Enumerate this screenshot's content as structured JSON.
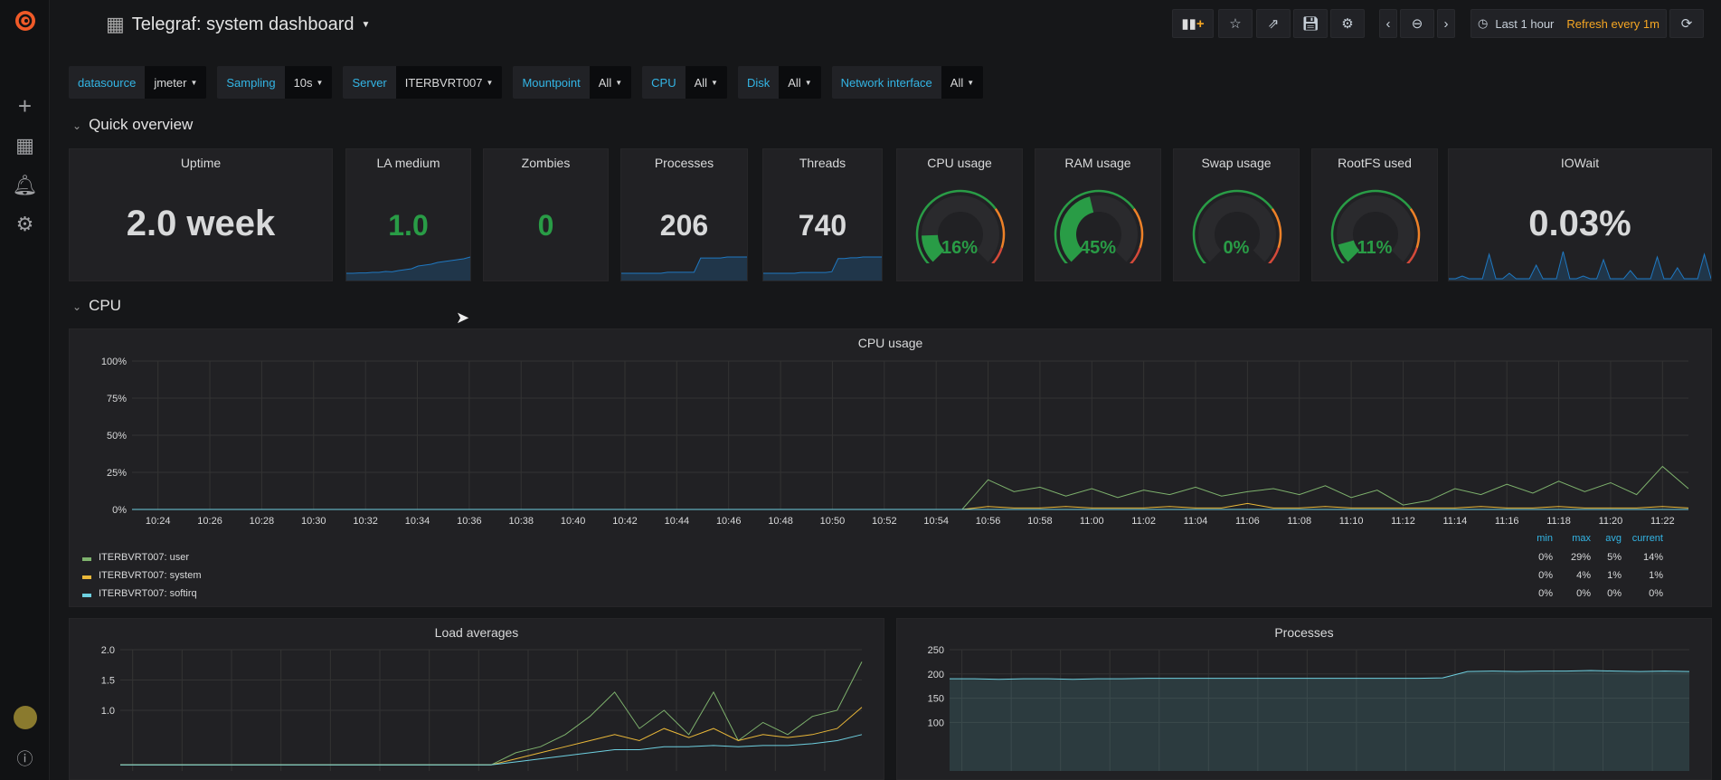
{
  "app": {
    "title": "Telegraf: system dashboard"
  },
  "sidebar": {
    "icons": [
      "grafana-logo",
      "plus-icon",
      "dashboards-icon",
      "bell-icon",
      "gear-icon",
      "avatar",
      "help-icon"
    ]
  },
  "toolbar": {
    "time_range": "Last 1 hour",
    "refresh": "Refresh every 1m",
    "icons": [
      "add-panel-icon",
      "star-icon",
      "share-icon",
      "save-icon",
      "settings-icon",
      "chevron-left-icon",
      "zoom-out-icon",
      "chevron-right-icon",
      "refresh-icon"
    ]
  },
  "variables": [
    {
      "label": "datasource",
      "value": "jmeter"
    },
    {
      "label": "Sampling",
      "value": "10s"
    },
    {
      "label": "Server",
      "value": "ITERBVRT007"
    },
    {
      "label": "Mountpoint",
      "value": "All"
    },
    {
      "label": "CPU",
      "value": "All"
    },
    {
      "label": "Disk",
      "value": "All"
    },
    {
      "label": "Network interface",
      "value": "All"
    }
  ],
  "rows": {
    "quick": "Quick overview",
    "cpu": "CPU"
  },
  "stats": [
    {
      "title": "Uptime",
      "value": "2.0 week",
      "color": "#d8d9da"
    },
    {
      "title": "LA medium",
      "value": "1.0",
      "color": "#299c46",
      "spark": [
        0.1,
        0.1,
        0.12,
        0.12,
        0.15,
        0.15,
        0.2,
        0.18,
        0.25,
        0.3,
        0.35,
        0.5,
        0.55,
        0.6,
        0.7,
        0.75,
        0.8,
        0.85,
        0.9,
        1.0
      ]
    },
    {
      "title": "Zombies",
      "value": "0",
      "color": "#299c46"
    },
    {
      "title": "Processes",
      "value": "206",
      "color": "#d8d9da",
      "spark": [
        190,
        190,
        190,
        190,
        190,
        190,
        190,
        191,
        191,
        191,
        191,
        191,
        205,
        205,
        205,
        205,
        206,
        206,
        206,
        206
      ]
    },
    {
      "title": "Threads",
      "value": "740",
      "color": "#d8d9da",
      "spark": [
        720,
        720,
        720,
        720,
        720,
        720,
        721,
        721,
        721,
        721,
        721,
        722,
        738,
        738,
        739,
        739,
        740,
        740,
        740,
        740
      ]
    },
    {
      "title": "CPU usage",
      "value": "16%",
      "percent": 16,
      "color": "#299c46"
    },
    {
      "title": "RAM usage",
      "value": "45%",
      "percent": 45,
      "color": "#299c46"
    },
    {
      "title": "Swap usage",
      "value": "0%",
      "percent": 0,
      "color": "#299c46"
    },
    {
      "title": "RootFS used",
      "value": "11%",
      "percent": 11,
      "color": "#299c46"
    },
    {
      "title": "IOWait",
      "value": "0.03%",
      "color": "#d8d9da",
      "spark": [
        0,
        0,
        0.1,
        0,
        0,
        0,
        0.9,
        0,
        0,
        0.2,
        0,
        0,
        0,
        0.5,
        0,
        0,
        0,
        1,
        0,
        0,
        0.1,
        0,
        0,
        0.7,
        0,
        0,
        0,
        0.3,
        0,
        0,
        0,
        0.8,
        0,
        0,
        0.4,
        0,
        0,
        0,
        0.9,
        0
      ]
    }
  ],
  "chart_data": [
    {
      "type": "line",
      "title": "CPU usage",
      "ylim": [
        0,
        100
      ],
      "yticks": [
        "0%",
        "25%",
        "50%",
        "75%",
        "100%"
      ],
      "xticks": [
        "10:24",
        "10:26",
        "10:28",
        "10:30",
        "10:32",
        "10:34",
        "10:36",
        "10:38",
        "10:40",
        "10:42",
        "10:44",
        "10:46",
        "10:48",
        "10:50",
        "10:52",
        "10:54",
        "10:56",
        "10:58",
        "11:00",
        "11:02",
        "11:04",
        "11:06",
        "11:08",
        "11:10",
        "11:12",
        "11:14",
        "11:16",
        "11:18",
        "11:20",
        "11:22"
      ],
      "x_start": "10:23",
      "x_step_min": 1,
      "legend_headers": [
        "min",
        "max",
        "avg",
        "current"
      ],
      "series": [
        {
          "name": "ITERBVRT007: user",
          "color": "#7eb26d",
          "stats": [
            "0%",
            "29%",
            "5%",
            "14%"
          ],
          "values": [
            0,
            0,
            0,
            0,
            0,
            0,
            0,
            0,
            0,
            0,
            0,
            0,
            0,
            0,
            0,
            0,
            0,
            0,
            0,
            0,
            0,
            0,
            0,
            0,
            0,
            0,
            0,
            0,
            0,
            0,
            0,
            0,
            0,
            20,
            12,
            15,
            9,
            14,
            8,
            13,
            10,
            15,
            9,
            12,
            14,
            10,
            16,
            8,
            13,
            3,
            6,
            14,
            10,
            17,
            11,
            19,
            12,
            18,
            10,
            29,
            14
          ]
        },
        {
          "name": "ITERBVRT007: system",
          "color": "#eab839",
          "stats": [
            "0%",
            "4%",
            "1%",
            "1%"
          ],
          "values": [
            0,
            0,
            0,
            0,
            0,
            0,
            0,
            0,
            0,
            0,
            0,
            0,
            0,
            0,
            0,
            0,
            0,
            0,
            0,
            0,
            0,
            0,
            0,
            0,
            0,
            0,
            0,
            0,
            0,
            0,
            0,
            0,
            0,
            2,
            1,
            1,
            2,
            1,
            1,
            1,
            2,
            1,
            1,
            4,
            1,
            1,
            2,
            1,
            1,
            1,
            1,
            1,
            2,
            1,
            1,
            2,
            1,
            1,
            1,
            2,
            1
          ]
        },
        {
          "name": "ITERBVRT007: softirq",
          "color": "#6ed0e0",
          "stats": [
            "0%",
            "0%",
            "0%",
            "0%"
          ],
          "values": [
            0,
            0,
            0,
            0,
            0,
            0,
            0,
            0,
            0,
            0,
            0,
            0,
            0,
            0,
            0,
            0,
            0,
            0,
            0,
            0,
            0,
            0,
            0,
            0,
            0,
            0,
            0,
            0,
            0,
            0,
            0,
            0,
            0,
            0,
            0,
            0,
            0,
            0,
            0,
            0,
            0,
            0,
            0,
            0,
            0,
            0,
            0,
            0,
            0,
            0,
            0,
            0,
            0,
            0,
            0,
            0,
            0,
            0,
            0,
            0,
            0
          ]
        }
      ]
    },
    {
      "type": "line",
      "title": "Load averages",
      "ylim": [
        0,
        2
      ],
      "yticks": [
        "1.0",
        "1.5",
        "2.0"
      ],
      "x_start": "10:23",
      "x_step_min": 2,
      "series": [
        {
          "color": "#7eb26d",
          "values": [
            0.1,
            0.1,
            0.1,
            0.1,
            0.1,
            0.1,
            0.1,
            0.1,
            0.1,
            0.1,
            0.1,
            0.1,
            0.1,
            0.1,
            0.1,
            0.1,
            0.3,
            0.4,
            0.6,
            0.9,
            1.3,
            0.7,
            1.0,
            0.6,
            1.3,
            0.5,
            0.8,
            0.6,
            0.9,
            1.0,
            1.8
          ]
        },
        {
          "color": "#eab839",
          "values": [
            0.1,
            0.1,
            0.1,
            0.1,
            0.1,
            0.1,
            0.1,
            0.1,
            0.1,
            0.1,
            0.1,
            0.1,
            0.1,
            0.1,
            0.1,
            0.1,
            0.2,
            0.3,
            0.4,
            0.5,
            0.6,
            0.5,
            0.7,
            0.55,
            0.7,
            0.5,
            0.6,
            0.55,
            0.6,
            0.7,
            1.05
          ]
        },
        {
          "color": "#6ed0e0",
          "values": [
            0.1,
            0.1,
            0.1,
            0.1,
            0.1,
            0.1,
            0.1,
            0.1,
            0.1,
            0.1,
            0.1,
            0.1,
            0.1,
            0.1,
            0.1,
            0.1,
            0.15,
            0.2,
            0.25,
            0.3,
            0.35,
            0.35,
            0.4,
            0.4,
            0.42,
            0.4,
            0.42,
            0.42,
            0.45,
            0.5,
            0.6
          ]
        }
      ]
    },
    {
      "type": "area",
      "title": "Processes",
      "ylim": [
        0,
        250
      ],
      "yticks": [
        "100",
        "150",
        "200",
        "250"
      ],
      "x_start": "10:23",
      "x_step_min": 2,
      "series": [
        {
          "color": "#6ed0e0",
          "values": [
            190,
            190,
            189,
            190,
            190,
            189,
            190,
            190,
            191,
            191,
            191,
            191,
            191,
            191,
            191,
            191,
            191,
            191,
            191,
            191,
            192,
            205,
            206,
            205,
            206,
            206,
            207,
            206,
            205,
            206,
            205
          ]
        }
      ]
    }
  ]
}
